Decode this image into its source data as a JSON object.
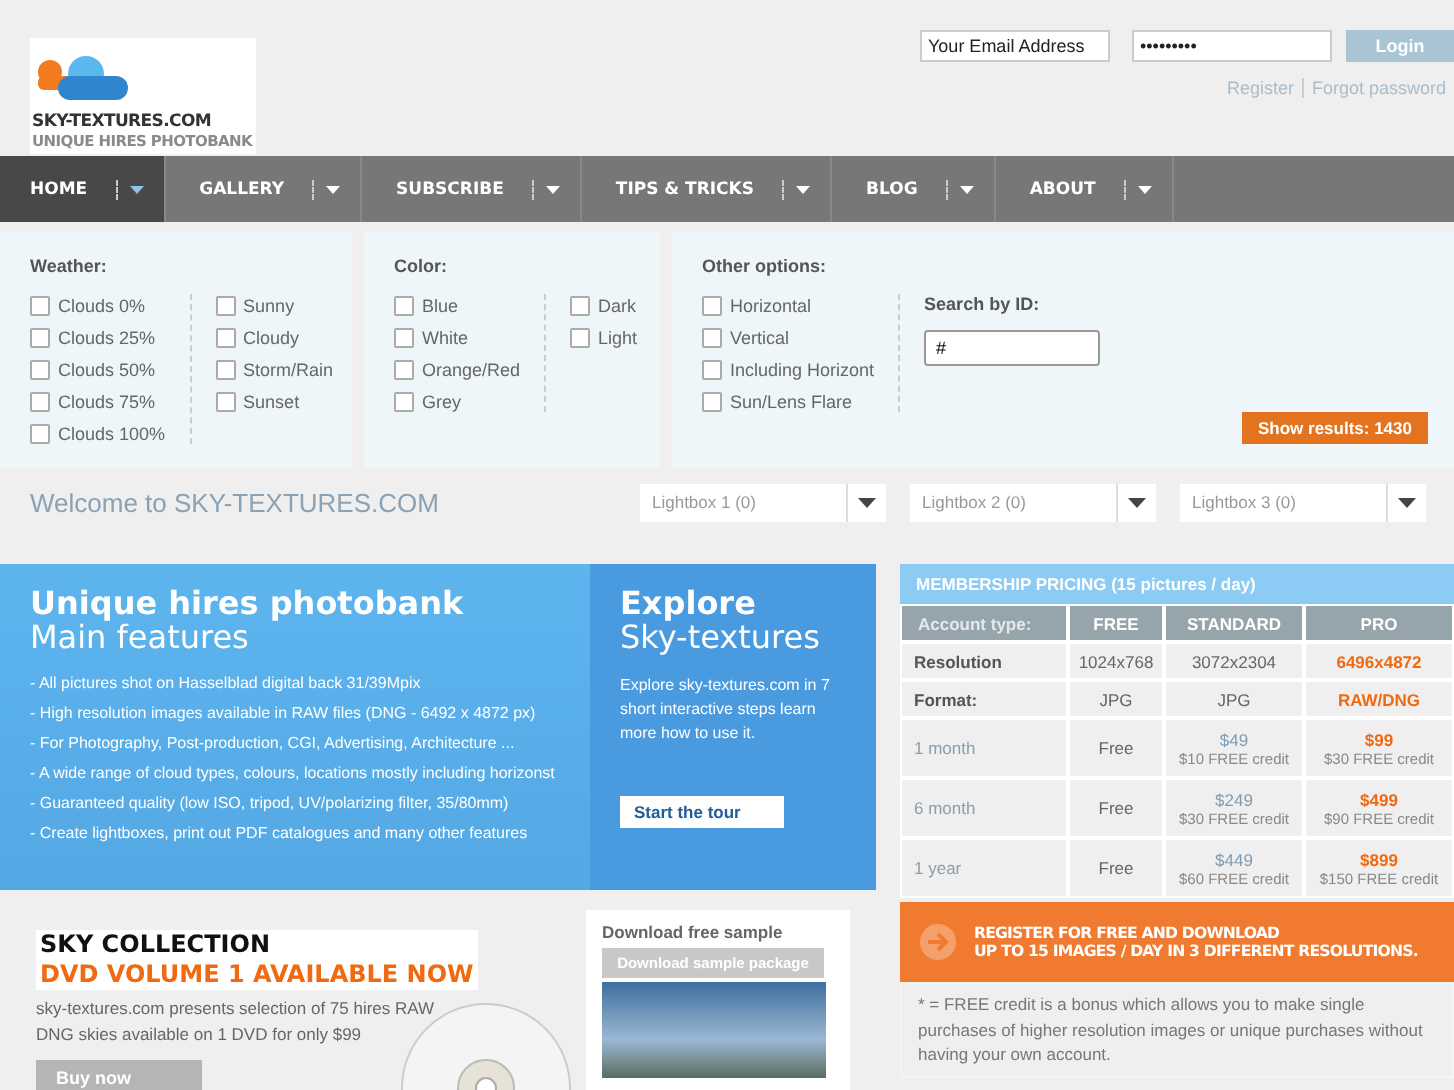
{
  "header": {
    "logo": {
      "title": "SKY-TEXTURES.COM",
      "subtitle": "UNIQUE HIRES PHOTOBANK"
    },
    "login": {
      "email": "Your Email Address",
      "password": "•••••••••",
      "button": "Login"
    },
    "links": [
      "Register",
      "Forgot password"
    ]
  },
  "nav": [
    {
      "label": "HOME",
      "selected": true
    },
    {
      "label": "GALLERY",
      "selected": false
    },
    {
      "label": "SUBSCRIBE",
      "selected": false
    },
    {
      "label": "TIPS & TRICKS",
      "selected": false
    },
    {
      "label": "BLOG",
      "selected": false
    },
    {
      "label": "ABOUT",
      "selected": false
    }
  ],
  "filters": [
    {
      "title": "Weather:",
      "columns": [
        [
          {
            "label": "Clouds 0%",
            "checked": false
          },
          {
            "label": "Clouds 25%",
            "checked": false
          },
          {
            "label": "Clouds 50%",
            "checked": false
          },
          {
            "label": "Clouds 75%",
            "checked": false
          },
          {
            "label": "Clouds 100%",
            "checked": false
          }
        ],
        [
          {
            "label": "Sunny",
            "checked": false
          },
          {
            "label": "Cloudy",
            "checked": false
          },
          {
            "label": "Storm/Rain",
            "checked": false
          },
          {
            "label": "Sunset",
            "checked": false
          }
        ]
      ]
    },
    {
      "title": "Color:",
      "columns": [
        [
          {
            "label": "Blue",
            "checked": false
          },
          {
            "label": "White",
            "checked": false
          },
          {
            "label": "Orange/Red",
            "checked": false
          },
          {
            "label": "Grey",
            "checked": false
          }
        ],
        [
          {
            "label": "Dark",
            "checked": false
          },
          {
            "label": "Light",
            "checked": false
          }
        ]
      ]
    },
    {
      "title": "Other options:",
      "columns": [
        [
          {
            "label": "Horizontal",
            "checked": false
          },
          {
            "label": "Vertical",
            "checked": false
          },
          {
            "label": "Including Horizont",
            "checked": false
          },
          {
            "label": "Sun/Lens Flare",
            "checked": false
          }
        ]
      ],
      "search": {
        "label": "Search by ID:",
        "value": "#"
      },
      "button": "Show results: 1430"
    }
  ],
  "welcome": {
    "text": "Welcome to SKY-TEXTURES.COM",
    "lightboxes": [
      "Lightbox 1 (0)",
      "Lightbox 2 (0)",
      "Lightbox 3 (0)"
    ]
  },
  "features": {
    "title": "Unique hires photobank",
    "subtitle": "Main features",
    "bullets": [
      "- All pictures shot on Hasselblad digital back 31/39Mpix",
      "- High resolution images available in RAW files (DNG - 6492 x 4872 px)",
      "- For Photography, Post-production, CGI, Advertising, Architecture ...",
      "- A wide range of cloud types, colours, locations mostly including horizonst",
      "- Guaranteed quality (low ISO, tripod, UV/polarizing filter, 35/80mm)",
      "- Create lightboxes, print out PDF catalogues and many other features"
    ]
  },
  "explore": {
    "title": "Explore",
    "subtitle": "Sky-textures",
    "text": "Explore sky-textures.com in 7 short interactive steps learn more how to use it.",
    "button": "Start the tour"
  },
  "pricing": {
    "title": "MEMBERSHIP PRICING (15 pictures / day)",
    "columns": [
      "Account type:",
      "FREE",
      "STANDARD",
      "PRO"
    ],
    "rows": [
      {
        "kind": "spec",
        "label": "Resolution",
        "cells": [
          "1024x768",
          "3072x2304",
          "6496x4872"
        ]
      },
      {
        "kind": "spec",
        "label": "Format:",
        "cells": [
          "JPG",
          "JPG",
          "RAW/DNG"
        ]
      },
      {
        "kind": "price",
        "label": "1 month",
        "free": "Free",
        "standard": {
          "price": "$49",
          "credit": "$10 FREE credit"
        },
        "pro": {
          "price": "$99",
          "credit": "$30 FREE credit"
        }
      },
      {
        "kind": "price",
        "label": "6 month",
        "free": "Free",
        "standard": {
          "price": "$249",
          "credit": "$30 FREE credit"
        },
        "pro": {
          "price": "$499",
          "credit": "$90 FREE credit"
        }
      },
      {
        "kind": "price",
        "label": "1 year",
        "free": "Free",
        "standard": {
          "price": "$449",
          "credit": "$60 FREE credit"
        },
        "pro": {
          "price": "$899",
          "credit": "$150 FREE credit"
        }
      }
    ]
  },
  "register": {
    "lines": [
      "REGISTER FOR FREE AND  DOWNLOAD",
      "UP TO 15 IMAGES / DAY IN 3 DIFFERENT RESOLUTIONS."
    ],
    "note": "* = FREE credit is a bonus which allows you to make single purchases of higher resolution images or unique purchases without having your own account."
  },
  "dvd": {
    "title": "SKY COLLECTION",
    "subtitle": "DVD VOLUME 1 AVAILABLE NOW",
    "text": "sky-textures.com presents selection of 75 hires RAW DNG skies available on 1 DVD for only $99",
    "button": "Buy now"
  },
  "sample": {
    "title": "Download free sample",
    "button": "Download sample package"
  }
}
